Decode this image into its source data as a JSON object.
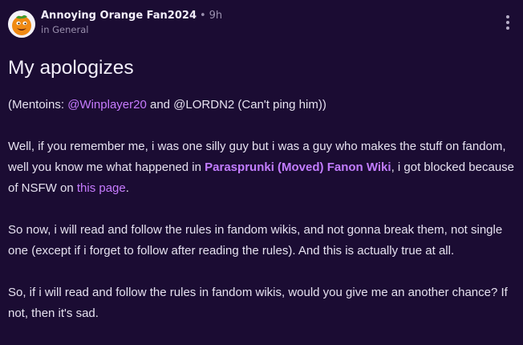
{
  "post": {
    "author": "Annoying Orange Fan2024",
    "separator": "•",
    "time": "9h",
    "category": "in General",
    "title": "My apologizes",
    "mentions_line": {
      "prefix": "(Mentoins: ",
      "mention_1": "@Winplayer20",
      "middle": " and @LORDN2 (Can't ping him))"
    },
    "paragraph_2": {
      "part_1": "Well, if you remember me, i was one silly guy but i was a guy who makes the stuff on fandom, well you know me what happened in ",
      "link_1": "Parasprunki (Moved) Fanon Wiki",
      "part_2": ", i got blocked because of NSFW on ",
      "link_2": "this page",
      "part_3": "."
    },
    "paragraph_3": "So now, i will read and follow the rules in fandom wikis, and not gonna break them, not single one (except if i forget to follow after reading the rules). And this is actually true at all.",
    "paragraph_4": "So, if i will read and follow the rules in fandom wikis, would you give me an another chance? If not, then it's sad."
  },
  "icons": {
    "avatar": "annoying-orange-avatar",
    "more": "vertical-ellipsis-icon"
  },
  "colors": {
    "background": "#1b0c33",
    "link": "#c77bff",
    "muted": "#9a90ae"
  }
}
